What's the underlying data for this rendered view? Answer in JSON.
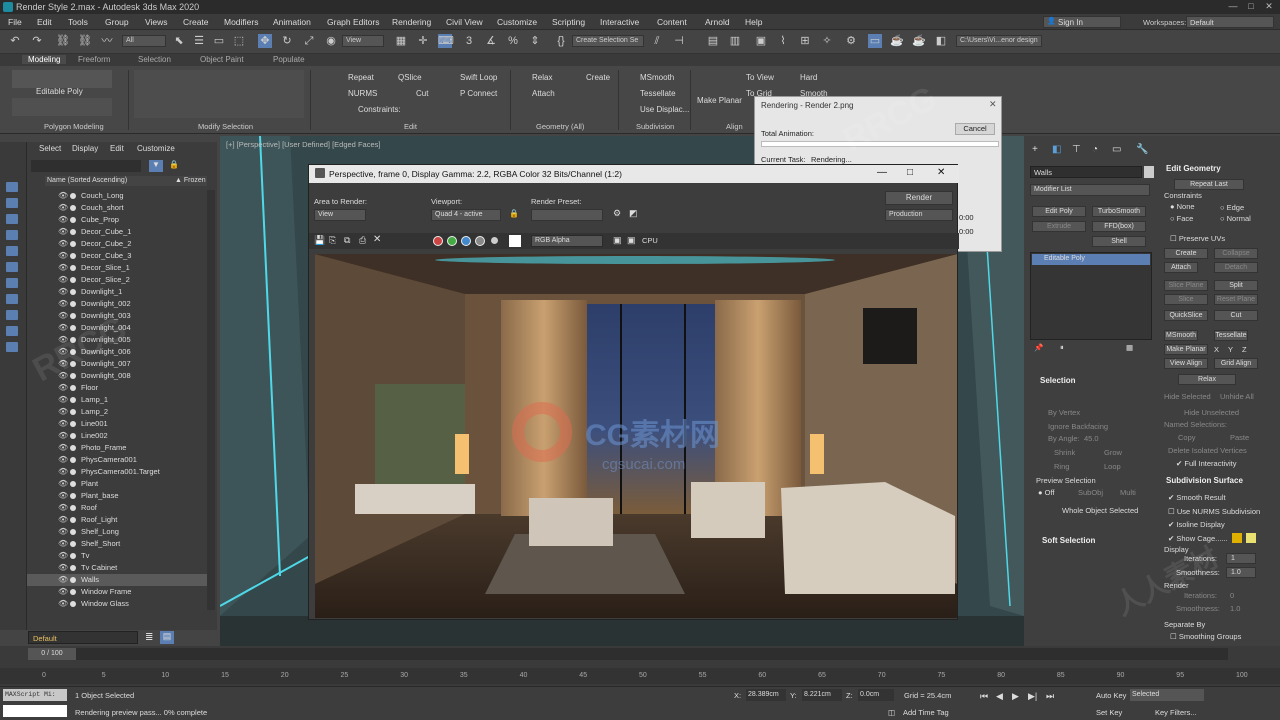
{
  "window": {
    "title": "Render Style 2.max - Autodesk 3ds Max 2020"
  },
  "menu": [
    "File",
    "Edit",
    "Tools",
    "Group",
    "Views",
    "Create",
    "Modifiers",
    "Animation",
    "Graph Editors",
    "Rendering",
    "Civil View",
    "Customize",
    "Scripting",
    "Interactive",
    "Content",
    "Arnold",
    "Help"
  ],
  "signin": "Sign In",
  "workspace_label": "Workspaces:",
  "workspace_value": "Default",
  "toolbar": {
    "filter": "All",
    "refcoord": "View",
    "selset": "Create Selection Se",
    "path": "C:\\Users\\Vi...enor design"
  },
  "ribbon_tabs": [
    "Modeling",
    "Freeform",
    "Selection",
    "Object Paint",
    "Populate"
  ],
  "ribbon": {
    "editable_poly": "Editable Poly",
    "polygon_modeling": "Polygon Modeling",
    "modify_selection": "Modify Selection",
    "edit": "Edit",
    "geometry": "Geometry (All)",
    "subdivision": "Subdivision",
    "align": "Align",
    "repeat": "Repeat",
    "qslice": "QSlice",
    "swift_loop": "Swift Loop",
    "nurms": "NURMS",
    "cut": "Cut",
    "p_connect": "P Connect",
    "constraints": "Constraints:",
    "relax": "Relax",
    "create": "Create",
    "attach": "Attach",
    "msmooth": "MSmooth",
    "tessellate": "Tessellate",
    "use_displac": "Use Displac...",
    "make_planar": "Make Planar",
    "to_view": "To View",
    "to_grid": "To Grid",
    "hard": "Hard",
    "smooth": "Smooth"
  },
  "explorer": {
    "menu": [
      "Select",
      "Display",
      "Edit",
      "Customize"
    ],
    "col_name": "Name (Sorted Ascending)",
    "col_frozen": "▲ Frozen",
    "objects": [
      "Couch_Long",
      "Couch_short",
      "Cube_Prop",
      "Decor_Cube_1",
      "Decor_Cube_2",
      "Decor_Cube_3",
      "Decor_Slice_1",
      "Decor_Slice_2",
      "Downlight_1",
      "Downlight_002",
      "Downlight_003",
      "Downlight_004",
      "Downlight_005",
      "Downlight_006",
      "Downlight_007",
      "Downlight_008",
      "Floor",
      "Lamp_1",
      "Lamp_2",
      "Line001",
      "Line002",
      "Photo_Frame",
      "PhysCamera001",
      "PhysCamera001.Target",
      "Plant",
      "Plant_base",
      "Roof",
      "Roof_Light",
      "Shelf_Long",
      "Shelf_Short",
      "Tv",
      "Tv Cabinet",
      "Walls",
      "Window Frame",
      "Window Glass"
    ],
    "layer": "Default"
  },
  "viewport_label": "[+] [Perspective] [User Defined] [Edged Faces]",
  "rendering_dialog": {
    "title": "Rendering - Render 2.png",
    "total_animation": "Total Animation:",
    "cancel": "Cancel",
    "current_task_label": "Current Task:",
    "current_task": "Rendering...",
    "time1": "0:00",
    "time2": "0:00"
  },
  "vfb": {
    "title": "Perspective, frame 0, Display Gamma: 2.2, RGBA Color 32 Bits/Channel (1:2)",
    "area_label": "Area to Render:",
    "area_value": "View",
    "viewport_label": "Viewport:",
    "viewport_value": "Quad 4 - active",
    "preset_label": "Render Preset:",
    "render_btn": "Render",
    "production": "Production",
    "channel": "RGB Alpha",
    "cpu": "CPU"
  },
  "command_panel": {
    "object_name": "Walls",
    "modifier_list": "Modifier List",
    "edit_poly": "Edit Poly",
    "turbosmooth": "TurboSmooth",
    "extrude": "Extrude",
    "ffd": "FFD(box)",
    "shell": "Shell",
    "stack_item": "Editable Poly",
    "selection": "Selection",
    "by_vertex": "By Vertex",
    "ignore_backfacing": "Ignore Backfacing",
    "by_angle": "By Angle:",
    "by_angle_val": "45.0",
    "shrink": "Shrink",
    "grow": "Grow",
    "ring": "Ring",
    "loop": "Loop",
    "preview_selection": "Preview Selection",
    "off": "Off",
    "subobj": "SubObj",
    "multi": "Multi",
    "whole_object": "Whole Object Selected",
    "soft_selection": "Soft Selection",
    "edit_geometry": "Edit Geometry",
    "repeat_last": "Repeat Last",
    "constraints": "Constraints",
    "none": "None",
    "edge": "Edge",
    "face": "Face",
    "normal": "Normal",
    "preserve_uvs": "Preserve UVs",
    "create": "Create",
    "collapse": "Collapse",
    "attach": "Attach",
    "detach": "Detach",
    "slice_plane": "Slice Plane",
    "split": "Split",
    "slice": "Slice",
    "reset_plane": "Reset Plane",
    "quickslice": "QuickSlice",
    "cut": "Cut",
    "msmooth": "MSmooth",
    "tessellate": "Tessellate",
    "make_planar": "Make Planar",
    "x": "X",
    "y": "Y",
    "z": "Z",
    "view_align": "View Align",
    "grid_align": "Grid Align",
    "relax": "Relax",
    "hide_selected": "Hide Selected",
    "unhide_all": "Unhide All",
    "hide_unselected": "Hide Unselected",
    "named_selections": "Named Selections:",
    "copy": "Copy",
    "paste": "Paste",
    "delete_isolated": "Delete Isolated Vertices",
    "full_interactivity": "Full Interactivity",
    "subdivision_surface": "Subdivision Surface",
    "smooth_result": "Smooth Result",
    "use_nurms": "Use NURMS Subdivision",
    "isoline": "Isoline Display",
    "show_cage": "Show Cage......",
    "display": "Display",
    "iterations": "Iterations:",
    "iter_val": "1",
    "smoothness": "Smoothness:",
    "smooth_val": "1.0",
    "render": "Render",
    "r_iterations": "Iterations:",
    "r_iter_val": "0",
    "r_smoothness": "Smoothness:",
    "r_smooth_val": "1.0",
    "separate_by": "Separate By",
    "smoothing_groups": "Smoothing Groups"
  },
  "timeline": {
    "frame": "0 / 100",
    "ticks": [
      "0",
      "5",
      "10",
      "15",
      "20",
      "25",
      "30",
      "35",
      "40",
      "45",
      "50",
      "55",
      "60",
      "65",
      "70",
      "75",
      "80",
      "85",
      "90",
      "95",
      "100"
    ]
  },
  "status": {
    "maxscript": "MAXScript Mi:",
    "selected": "1 Object Selected",
    "rendering": "Rendering preview pass... 0% complete",
    "x_label": "X:",
    "x": "28.389cm",
    "y_label": "Y:",
    "y": "8.221cm",
    "z_label": "Z:",
    "z": "0.0cm",
    "grid": "Grid = 25.4cm",
    "add_time_tag": "Add Time Tag",
    "auto_key": "Auto Key",
    "set_key": "Set Key",
    "selected_dd": "Selected",
    "key_filters": "Key Filters..."
  },
  "watermarks": [
    "RRCG",
    "人人素材",
    "CG素材网",
    "cgsucai.com"
  ]
}
